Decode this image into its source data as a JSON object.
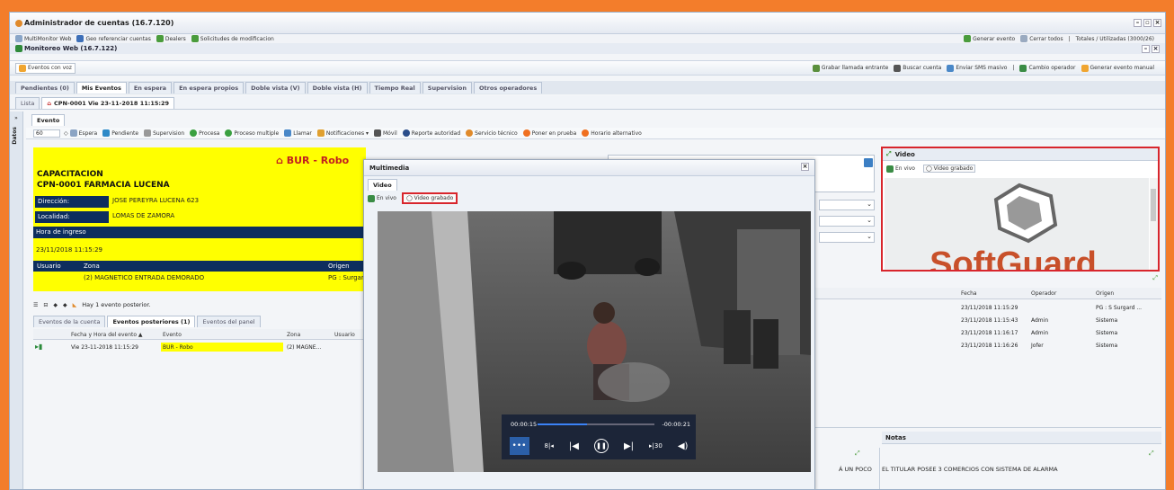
{
  "window": {
    "title": "Administrador de cuentas (16.7.120)",
    "menu": [
      "MultiMonitor Web",
      "Geo referenciar cuentas",
      "Dealers",
      "Solicitudes de modificacion"
    ],
    "menu_right": [
      "Generar evento",
      "Cerrar todos",
      "|",
      "Totales / Utilizadas (3000/26)"
    ],
    "subtitle": "Monitoreo Web (16.7.122)"
  },
  "toolbar": {
    "left": "Eventos con voz",
    "right": [
      "Grabar llamada entrante",
      "Buscar cuenta",
      "Enviar SMS masivo",
      "|",
      "Cambio operador",
      "Generar evento manual"
    ]
  },
  "tabs": [
    "Pendientes (0)",
    "Mis Eventos",
    "En espera",
    "En espera propios",
    "Doble vista (V)",
    "Doble vista (H)",
    "Tiempo Real",
    "Supervision",
    "Otros operadores"
  ],
  "list": {
    "label": "Lista",
    "event_tab": "CPN-0001 Vie 23-11-2018 11:15:29"
  },
  "sidebar_label": "Datos",
  "event_tab": "Evento",
  "action_bar": {
    "count": "60",
    "items": [
      "Espera",
      "Pendiente",
      "Supervision",
      "Procesa",
      "Proceso multiple",
      "Llamar",
      "Notificaciones ▾",
      "Móvil",
      "Reporte autoridad",
      "Servicio técnico",
      "Poner en prueba",
      "Horario alternativo"
    ]
  },
  "event": {
    "alarm": "BUR - Robo",
    "name1": "CAPACITACION",
    "name2": "CPN-0001 FARMACIA LUCENA",
    "direccion_label": "Dirección:",
    "direccion": "JOSE PEREYRA LUCENA 623",
    "localidad_label": "Localidad:",
    "localidad": "LOMAS DE ZAMORA",
    "hora_label": "Hora de ingreso",
    "hora": "23/11/2018 11:15:29",
    "col_usuario": "Usuario",
    "col_zona": "Zona",
    "col_origen": "Origen",
    "zona": "(2) MAGNETICO ENTRADA DEMORADO",
    "origen": "PG : Surgar"
  },
  "posterior_text": "Hay 1 evento posterior.",
  "sub_tabs": [
    "Eventos de la cuenta",
    "Eventos posteriores (1)",
    "Eventos del panel"
  ],
  "sub_grid": {
    "headers": [
      "Fecha y Hora del evento ▲",
      "Evento",
      "Zona",
      "Usuario"
    ],
    "row": [
      "Vie 23-11-2018 11:15:29",
      "BUR - Robo",
      "(2) MAGNE..."
    ]
  },
  "history": {
    "headers": [
      "Fecha",
      "Operador",
      "Origen"
    ],
    "rows": [
      [
        "23/11/2018 11:15:29",
        "",
        "PG : S Surgard ..."
      ],
      [
        "23/11/2018 11:15:43",
        "Admin",
        "Sistema"
      ],
      [
        "23/11/2018 11:16:17",
        "Admin",
        "Sistema"
      ],
      [
        "23/11/2018 11:16:26",
        "Jofer",
        "Sistema"
      ]
    ]
  },
  "notas": {
    "label": "Notas",
    "text": "EL TITULAR POSEE 3 COMERCIOS CON SISTEMA DE ALARMA",
    "left_snippet": "Á UN POCO"
  },
  "video_panel": {
    "title": "Video",
    "live": "En vivo",
    "recorded": "Video grabado",
    "logo": "SoftGuard"
  },
  "multimedia": {
    "title": "Multimedia",
    "tab": "Video",
    "live": "En vivo",
    "recorded": "Video grabado",
    "time_elapsed": "00:00:15",
    "time_left": "-00:00:21",
    "progress": 0.42,
    "skip_back": "8",
    "skip_fwd": "30"
  },
  "colors": {
    "orange": "#f37d2b",
    "yellow": "#ffff00",
    "navy": "#0d2e5e",
    "red": "#d8252c",
    "alarm_red": "#c21f1f"
  }
}
